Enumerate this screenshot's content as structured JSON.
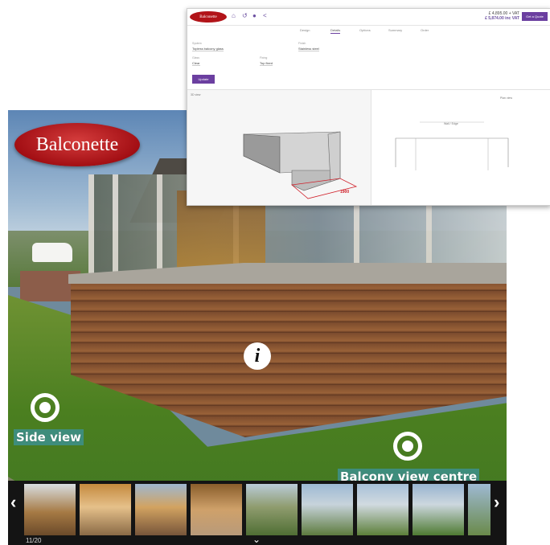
{
  "viewer": {
    "logo_text": "Balconette",
    "hotspots": [
      {
        "label": "Side view"
      },
      {
        "label": "Balcony view centre"
      }
    ],
    "counter": "11/20",
    "prev_arrow": "‹",
    "next_arrow": "›",
    "collapse_chevron": "⌄",
    "thumbnail_count": 9
  },
  "configurator": {
    "logo_text": "Balconette",
    "total_line1": "£ 4,895.00 + VAT",
    "total_line2": "£ 5,874.00 inc VAT",
    "quote_button": "Get a Quote",
    "tabs": [
      "Design",
      "Details",
      "Options",
      "Summary",
      "Order"
    ],
    "active_tab": "Details",
    "fields": [
      {
        "label": "System",
        "value": "Topless balcony glass"
      },
      {
        "label": "Finish",
        "value": "Stainless steel"
      },
      {
        "label": "Glass",
        "value": "Clear"
      },
      {
        "label": "Fixing",
        "value": "Top fixed"
      }
    ],
    "update_button": "Update",
    "view_label": "3D view",
    "plan_label": "Plan view",
    "dimension_label": "1900",
    "edge_label": "Wall / Edge",
    "colors": {
      "accent": "#6b3fa0",
      "brand_red": "#b21419",
      "dim_red": "#d0202a"
    }
  }
}
